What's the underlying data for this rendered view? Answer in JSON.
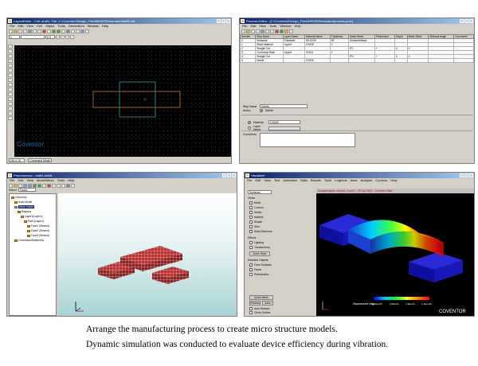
{
  "layout_editor": {
    "title": "LayoutEditor - Cell: draft1, File: C:\\Coventor\\Design_Files\\MEMS\\Resonator\\draft1.cat",
    "menu": [
      "File",
      "Edit",
      "View",
      "Cell",
      "Object",
      "Tools",
      "Generators",
      "Window",
      "Help"
    ],
    "layer_field": "1",
    "scale_field": "0.5",
    "watermark": "Coventor",
    "status_coord": "(46.4, 5)",
    "status_mode": "Command Mode",
    "colors": {
      "canvas": "#000000",
      "outer_rect": "#c87a2a",
      "inner_rect": "#2aa0a0"
    }
  },
  "process_editor": {
    "title": "Process Editor - [C:\\Coventor\\Design_Files\\MEMS\\Resonator\\process.proc]",
    "menu": [
      "File",
      "Edit",
      "View",
      "Tools",
      "Window",
      "Help"
    ],
    "columns": [
      "Number",
      "Step Name",
      "Layer Name",
      "Material Name",
      "Thickness",
      "Mask Name",
      "Photoresist",
      "Depth",
      "Mask Offset",
      "Sidewall Angle",
      "Comments"
    ],
    "rows": [
      [
        "0",
        "Substrate",
        "Substrate",
        "SILICON",
        "50",
        "SubstrateMask",
        "",
        "",
        "",
        "",
        ""
      ],
      [
        "1",
        "Stack Material",
        "Layer1",
        "OXIDE",
        "1",
        "",
        "",
        "",
        "",
        "",
        ""
      ],
      [
        "2",
        "Straight Cut",
        "",
        "",
        "",
        "PC",
        "+",
        "0",
        "0",
        "",
        ""
      ],
      [
        "3",
        "Conformal Shell",
        "Layer2",
        "GOLD",
        "1",
        "",
        "",
        "",
        "",
        "",
        ""
      ],
      [
        "4",
        "Straight Cut",
        "",
        "",
        "",
        "PG",
        "+",
        "0",
        "0",
        "",
        ""
      ],
      [
        "5",
        "Delete",
        "",
        "OXIDE",
        "",
        "",
        "",
        "",
        "",
        "",
        ""
      ]
    ],
    "step_name_label": "Step Name",
    "step_name_value": "Delete",
    "action_label": "Action",
    "action_value": "Delete",
    "material_label": "Material",
    "material_value": "OXIDE",
    "layer_name_label": "Layer Name",
    "comments_label": "Comments"
  },
  "preprocessor": {
    "title": "Preprocessor - draft1.draft1",
    "menu": [
      "File",
      "Edit",
      "View",
      "Model/Mesh",
      "Tools",
      "Help"
    ],
    "select_label": "Select",
    "select_value": "Faces",
    "tree": [
      "Geometry",
      "Solid Model",
      "Mesh Model",
      "Regions",
      "Layer1(Layer1)",
      "Part1(Layer1)",
      "Face1 (Shared)",
      "Face2 (Shared)",
      "Face3 (Shared)",
      "ConductorsDielectrics"
    ],
    "colors": {
      "mesh": "#b83030",
      "background_top": "#ffffff",
      "background_bottom": "#a9d3d6"
    }
  },
  "visualizer": {
    "title": "Visualizer",
    "menu": [
      "File",
      "Edit",
      "View",
      "Tool",
      "Animation",
      "Data",
      "Results",
      "Tools",
      "Legends",
      "Axes",
      "Analysis",
      "Controls",
      "Help"
    ],
    "surfaces_label": "Surfaces",
    "views_label": "Views",
    "view_options": [
      "Mesh",
      "Contour",
      "Vector",
      "Isolines",
      "Shade",
      "Wire",
      "Solid Elements"
    ],
    "effects_label": "Effects",
    "effects": [
      "Lighting",
      "Translucency"
    ],
    "zoom_label": "Zoom Style",
    "selected_label": "Selected Objects",
    "selected": [
      "Face Surfaces",
      "Faces",
      "Perturbation"
    ],
    "quick_mesh_button": "Quick Mesh",
    "redraw_button": "Redraw",
    "axes_button": "Axes",
    "autoredraw_label": "Auto Redraw",
    "grid_label": "Circle Outline",
    "plot_title": "Modalanalysis, modal1, mode1 - 29 Jan 2001 - Coventor Data",
    "legend_title": "Displacement Mag.",
    "legend_ticks": [
      "0.00e+00",
      "3.69e-01",
      "7.38e-01",
      "1.11e+00"
    ],
    "watermark": "COVENTOR",
    "colors": {
      "background": "#000000",
      "base": "#1a1ab0"
    }
  },
  "caption": {
    "line1": "Arrange the manufacturing process to create micro structure models.",
    "line2": "Dynamic simulation was conducted to evaluate device efficiency during vibration."
  }
}
